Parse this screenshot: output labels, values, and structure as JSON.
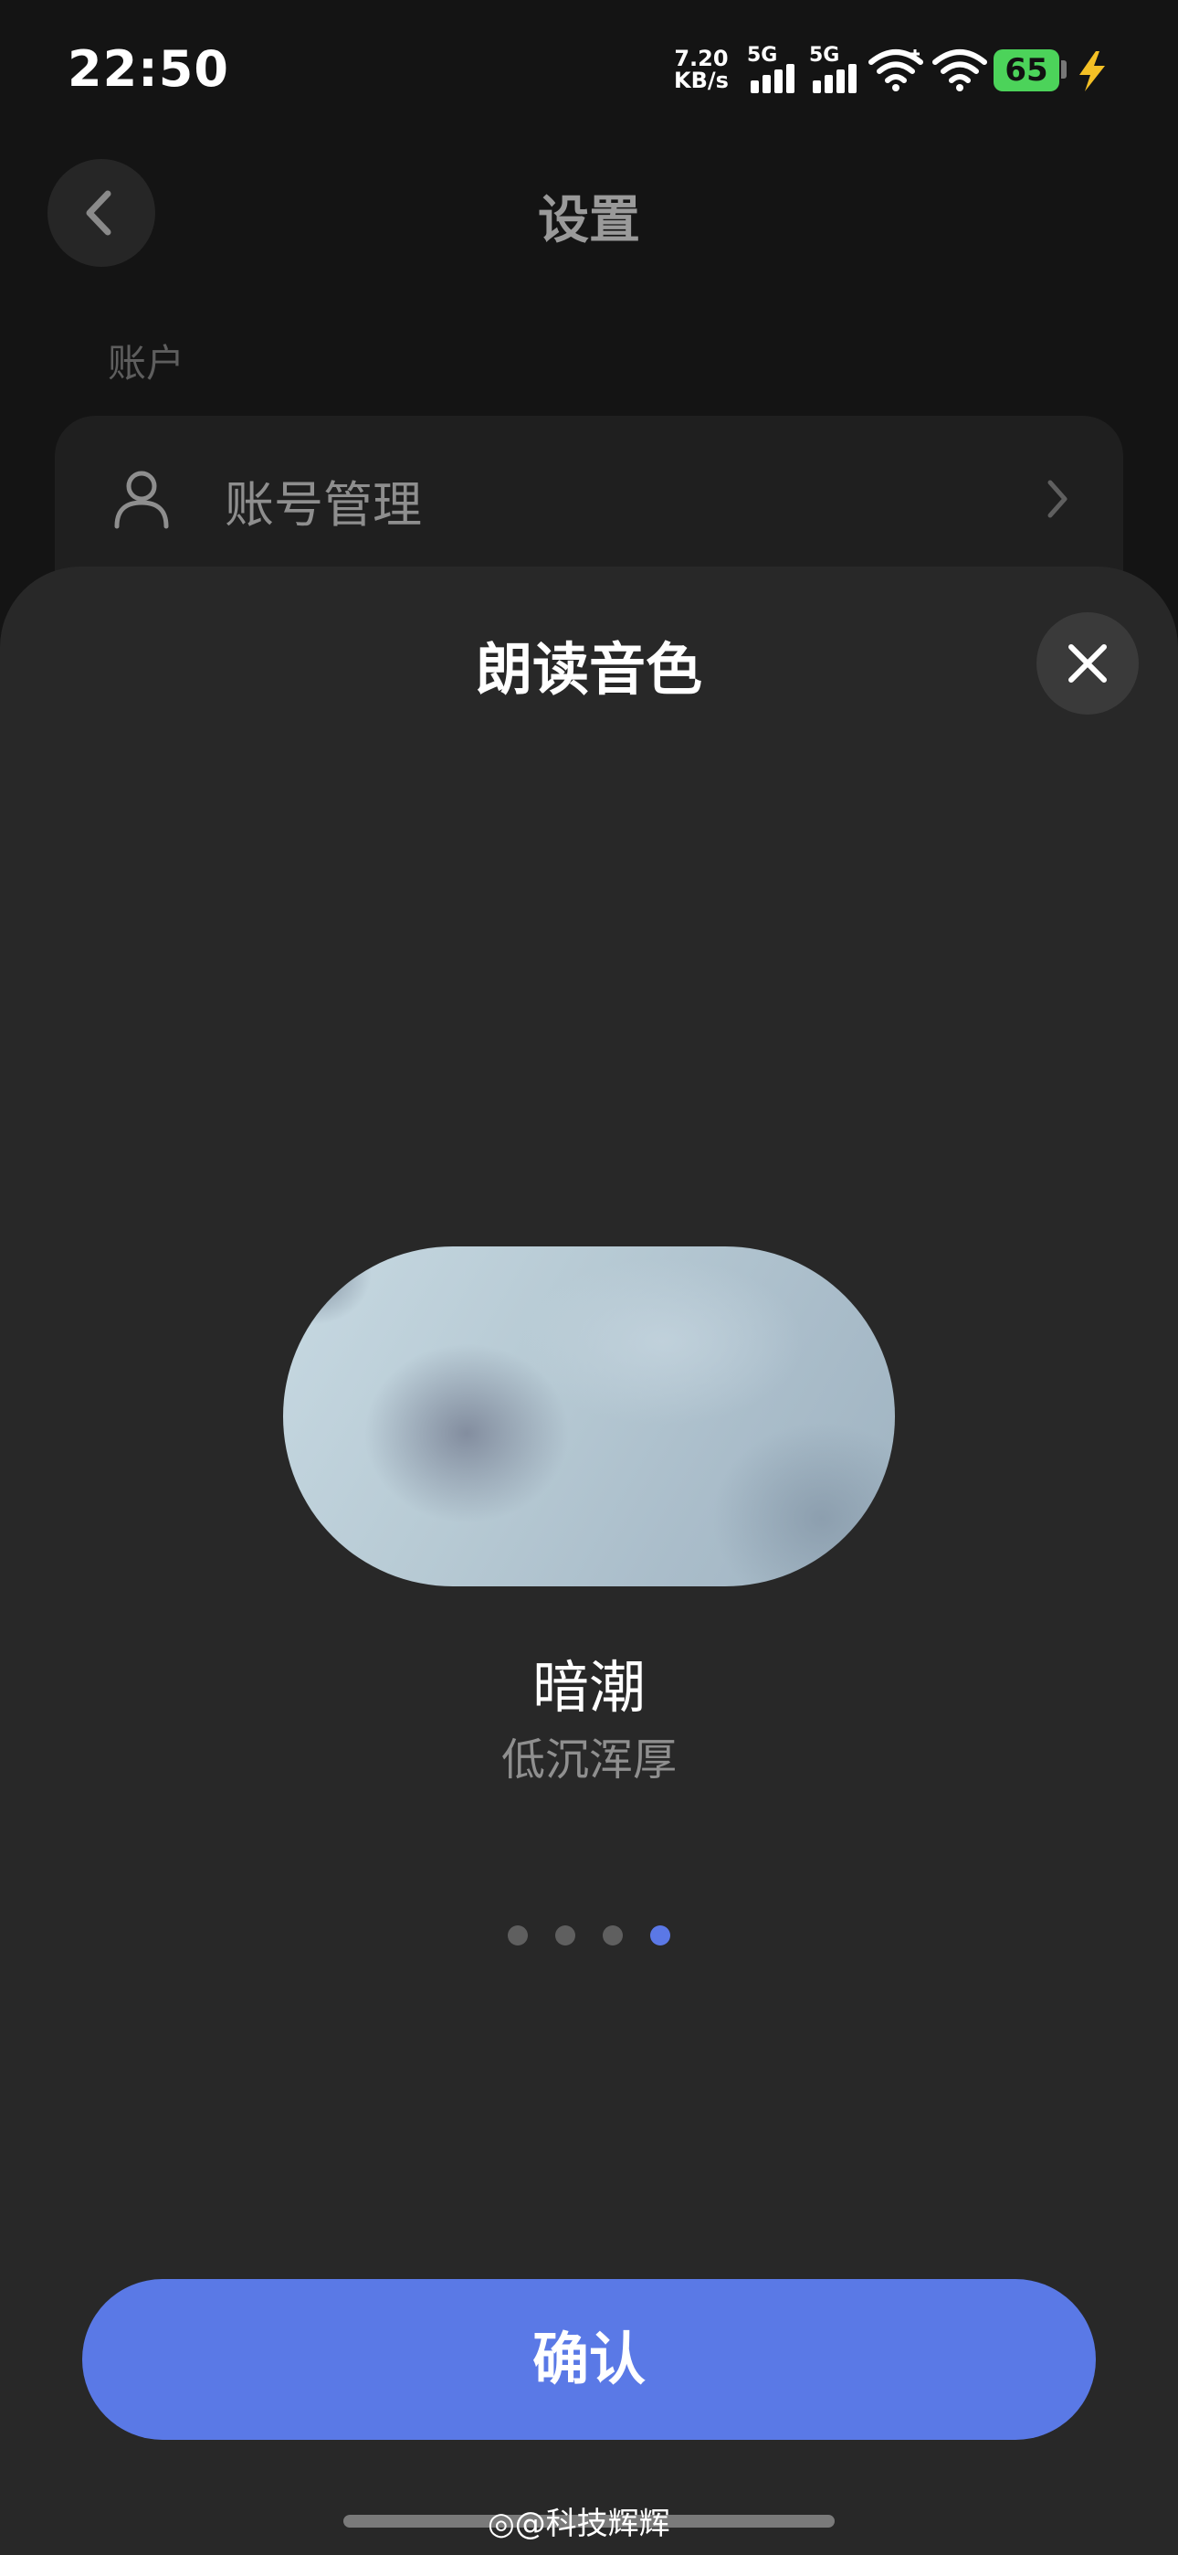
{
  "status_bar": {
    "time": "22:50",
    "net_speed_value": "7.20",
    "net_speed_unit": "KB/s",
    "signal_1_label": "5G",
    "signal_2_label": "5G",
    "battery_level": "65",
    "icons": [
      "signal-icon",
      "wifi-icon",
      "battery-icon",
      "charging-icon"
    ]
  },
  "background_page": {
    "title": "设置",
    "section_label": "账户",
    "account_item_label": "账号管理",
    "icons": [
      "back-icon",
      "user-icon",
      "chevron-right-icon"
    ]
  },
  "sheet": {
    "title": "朗读音色",
    "voice": {
      "name": "暗潮",
      "description": "低沉浑厚"
    },
    "pagination": {
      "total": 4,
      "active_index": 3
    },
    "confirm_label": "确认",
    "accent_color": "#5a79e6"
  },
  "watermark": "@科技辉辉"
}
